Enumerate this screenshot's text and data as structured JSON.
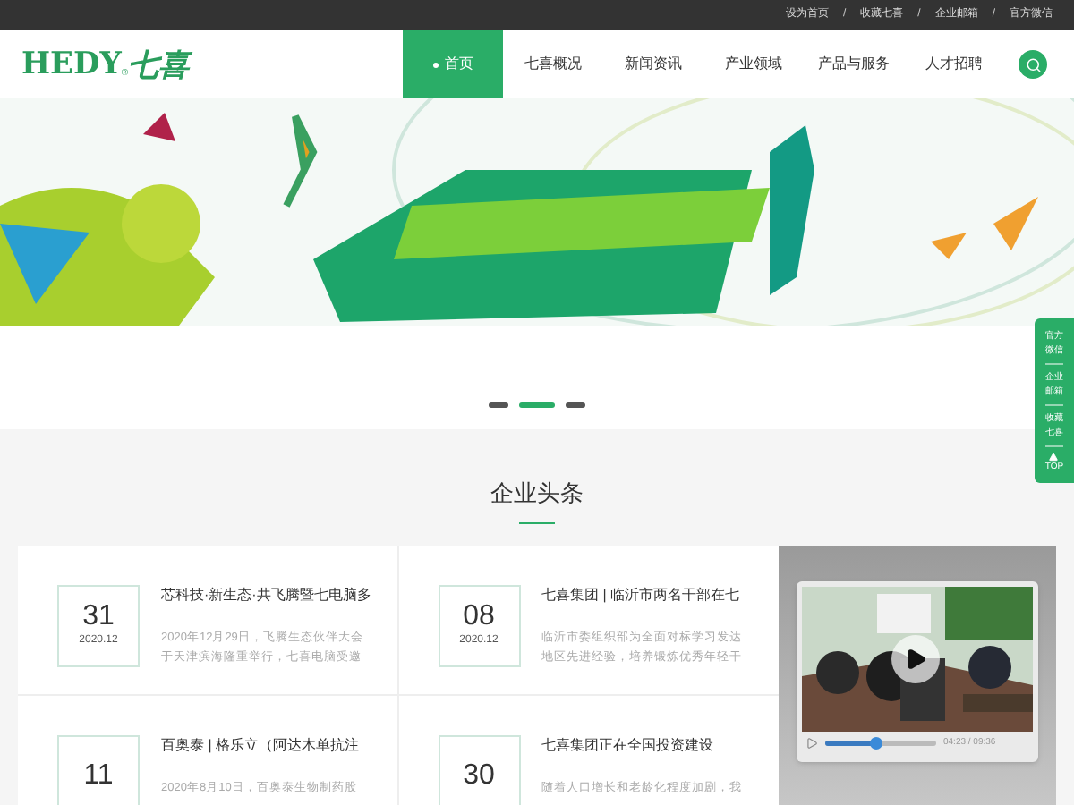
{
  "top_links": [
    "设为首页",
    "收藏七喜",
    "企业邮箱",
    "官方微信"
  ],
  "top_separators": [
    "/",
    "/",
    "/"
  ],
  "logo": {
    "latin": "HEDY",
    "mark": "®",
    "chinese": "七喜"
  },
  "nav": [
    {
      "label": "首页",
      "selected": true
    },
    {
      "label": "七喜概况",
      "selected": false
    },
    {
      "label": "新闻资讯",
      "selected": false
    },
    {
      "label": "产业领域",
      "selected": false
    },
    {
      "label": "产品与服务",
      "selected": false
    },
    {
      "label": "人才招聘",
      "selected": false
    }
  ],
  "banner": {
    "kind": "picture",
    "dots": [
      {
        "selected": false
      },
      {
        "selected": true
      },
      {
        "selected": false
      }
    ]
  },
  "side_bar": [
    "官方微信",
    "企业邮箱",
    "收藏七喜"
  ],
  "side_top": "TOP",
  "section_title": "企业头条",
  "news": [
    {
      "day": "31",
      "month": "2020.12",
      "title": "芯科技·新生态·共飞腾暨七电脑多",
      "excerpt": [
        "2020年12月29日，飞腾生态伙伴大会",
        "于天津滨海隆重举行，七喜电脑受邀"
      ]
    },
    {
      "day": "08",
      "month": "2020.12",
      "title": "七喜集团 | 临沂市两名干部在七",
      "excerpt": [
        "临沂市委组织部为全面对标学习发达",
        "地区先进经验，培养锻炼优秀年轻干"
      ]
    },
    {
      "day": "11",
      "title": "百奥泰 | 格乐立（阿达木单抗注",
      "excerpt": [
        "2020年8月10日，百奥泰生物制药股"
      ]
    },
    {
      "day": "30",
      "title": "七喜集团正在全国投资建设",
      "excerpt": [
        "随着人口增长和老龄化程度加剧，我"
      ]
    }
  ],
  "video": {
    "level": 0.45,
    "time": "04:23 / 09:36"
  }
}
